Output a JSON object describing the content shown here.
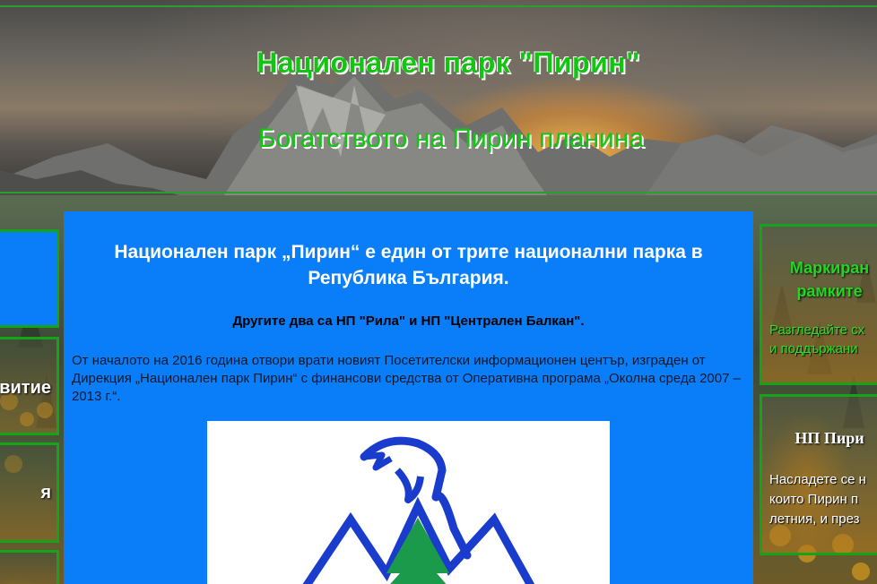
{
  "header": {
    "title": "Национален парк \"Пирин\"",
    "subtitle": "Богатството на Пирин планина"
  },
  "left_sidebar": {
    "box2_label": "витие",
    "box3_label": "я"
  },
  "main": {
    "heading": "Национален парк „Пирин“ е един от трите национални парка в Република България.",
    "subheading": "Другите два са НП \"Рила\" и НП \"Централен Балкан\".",
    "paragraph": "От началото на 2016 година отвори врати новият Посетителски информационен център, изграден от Дирекция „Национален парк Пирин“ с финансови средства от Оперативна програма „Околна среда 2007 – 2013 г.“."
  },
  "right_sidebar": {
    "box1": {
      "title_line1": "Маркиран",
      "title_line2": "рамките",
      "text_line1": "Разгледайте сх",
      "text_line2": "и поддържани"
    },
    "box2": {
      "title": "НП Пири",
      "text_line1": "Насладете се н",
      "text_line2": "които Пирин п",
      "text_line3": "летния, и през"
    }
  },
  "logo": {
    "icon": "eagle-mountain-tree-logo",
    "colors": {
      "outline": "#1a3ccc",
      "tree": "#1a9a4a"
    }
  },
  "colors": {
    "accent_green": "#13c413",
    "content_blue": "#0a7ef8",
    "border_green": "#17a317"
  }
}
